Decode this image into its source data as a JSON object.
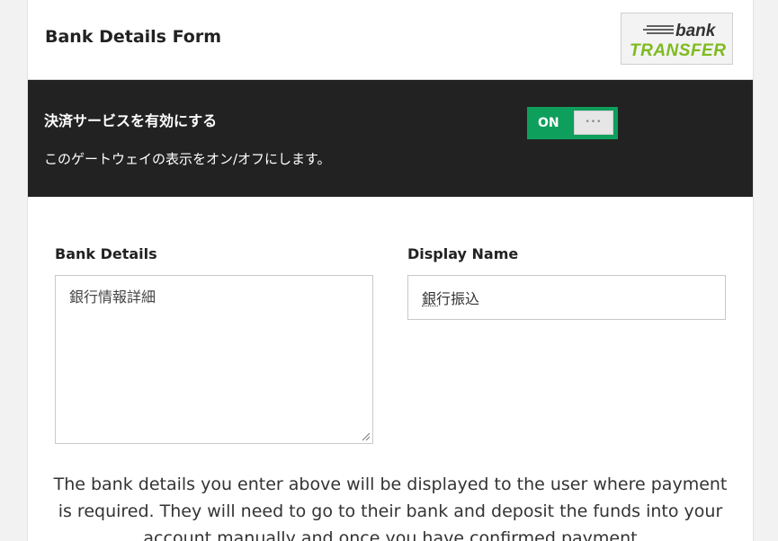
{
  "header": {
    "title": "Bank Details Form",
    "logo": {
      "line1": "bank",
      "line2": "TRANSFER"
    }
  },
  "gateway": {
    "enable_title": "決済サービスを有効にする",
    "enable_description": "このゲートウェイの表示をオン/オフにします。",
    "toggle_label": "ON",
    "toggle_knob_glyph": "•••"
  },
  "form": {
    "bank_details_label": "Bank Details",
    "bank_details_value": "銀行情報詳細",
    "display_name_label": "Display Name",
    "display_name_value": "銀行振込"
  },
  "help_text": "The bank details you enter above will be displayed to the user where payment is required. They will need to go to their bank and deposit the funds into your account manually and once you have confirmed payment",
  "colors": {
    "dark_band": "#222222",
    "toggle_on": "#0e9f5c",
    "logo_green": "#7dbb1e"
  }
}
